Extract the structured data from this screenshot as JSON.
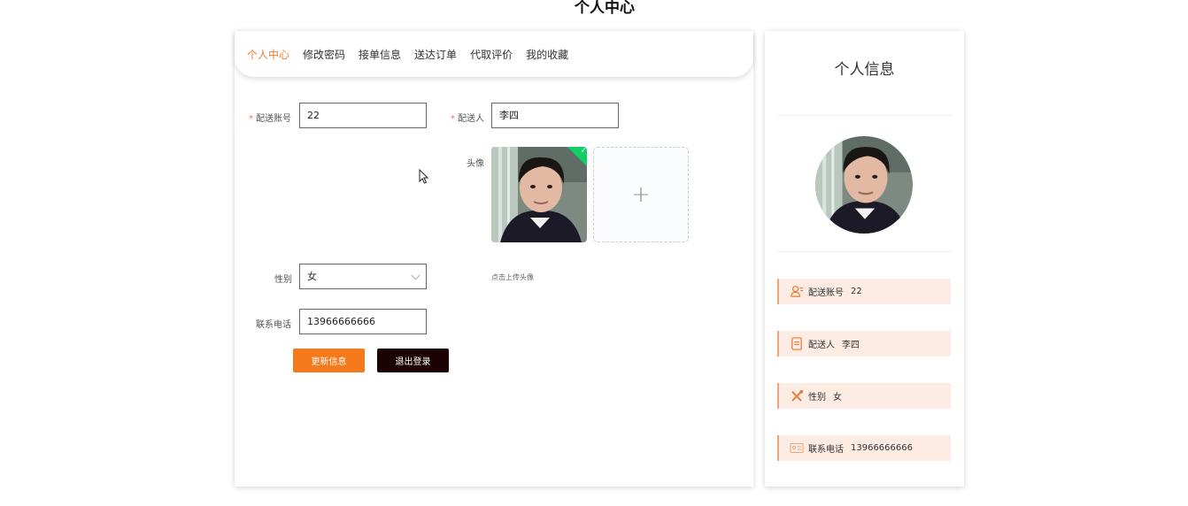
{
  "page": {
    "title": "个人中心"
  },
  "tabs": [
    {
      "label": "个人中心",
      "active": true
    },
    {
      "label": "修改密码",
      "active": false
    },
    {
      "label": "接单信息",
      "active": false
    },
    {
      "label": "送达订单",
      "active": false
    },
    {
      "label": "代取评价",
      "active": false
    },
    {
      "label": "我的收藏",
      "active": false
    }
  ],
  "form": {
    "account_label": "配送账号",
    "account_value": "22",
    "name_label": "配送人",
    "name_value": "李四",
    "avatar_label": "头像",
    "upload_tip": "点击上传头像",
    "gender_label": "性别",
    "gender_value": "女",
    "phone_label": "联系电话",
    "phone_value": "13966666666",
    "required_mark": "*",
    "upload_plus": "+"
  },
  "buttons": {
    "update": "更新信息",
    "logout": "退出登录"
  },
  "profile": {
    "title": "个人信息",
    "rows": [
      {
        "label": "配送账号",
        "value": "22",
        "icon": "user-card-icon"
      },
      {
        "label": "配送人",
        "value": "李四",
        "icon": "document-icon"
      },
      {
        "label": "性别",
        "value": "女",
        "icon": "tools-icon"
      },
      {
        "label": "联系电话",
        "value": "13966666666",
        "icon": "id-card-icon"
      }
    ]
  },
  "colors": {
    "accent": "#f07c2a",
    "update_button": "#f47a1c",
    "logout_button": "#1c0303",
    "info_row_bg": "#fdece3",
    "success": "#13ce66"
  }
}
